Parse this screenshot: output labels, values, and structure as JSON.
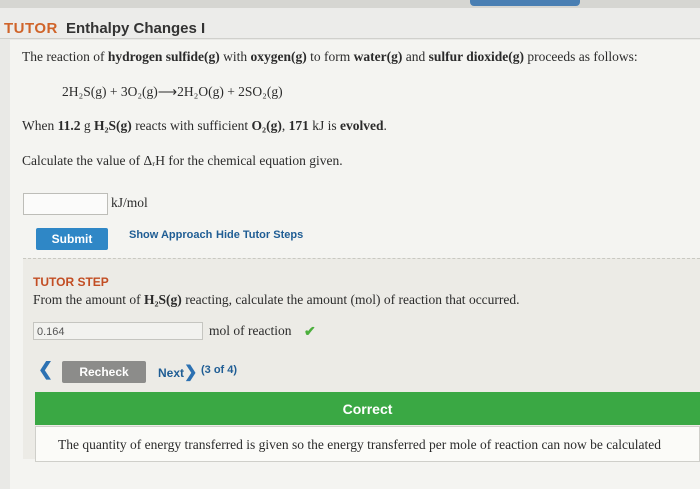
{
  "header": {
    "tutor_label": "TUTOR",
    "title": "Enthalpy Changes I"
  },
  "question": {
    "intro_a": "The reaction of ",
    "intro_b": "hydrogen sulfide(g)",
    "intro_c": " with ",
    "intro_d": "oxygen(g)",
    "intro_e": " to form ",
    "intro_f": "water(g)",
    "intro_g": " and ",
    "intro_h": "sulfur dioxide(g)",
    "intro_i": " proceeds as follows:",
    "equation": "2H₂S(g) + 3O₂(g)⟶2H₂O(g) + 2SO₂(g)",
    "given_a": "When ",
    "given_b": "11.2",
    "given_c": " g ",
    "given_d": "H₂S(g)",
    "given_e": " reacts with sufficient ",
    "given_f": "O₂(g)",
    "given_g": ", ",
    "given_h": "171",
    "given_i": " kJ is ",
    "given_j": "evolved",
    "given_k": ".",
    "prompt": "Calculate the value of ΔᵣH for the chemical equation given.",
    "answer_value": "",
    "answer_unit": "kJ/mol"
  },
  "actions": {
    "submit_label": "Submit",
    "show_approach_label": "Show Approach",
    "hide_steps_label": "Hide Tutor Steps"
  },
  "tutor_step": {
    "heading": "TUTOR STEP",
    "instruction_a": "From the amount of ",
    "instruction_b": "H₂S(g)",
    "instruction_c": " reacting, calculate the amount (mol) of reaction that occurred.",
    "answer_value": "0.164",
    "answer_unit": "mol of reaction",
    "check_mark": "✔",
    "recheck_label": "Recheck",
    "next_label": "Next",
    "step_counter": "(3 of 4)",
    "result_label": "Correct",
    "feedback": "The quantity of energy transferred is given so the energy transferred per mole of reaction can now be calculated"
  },
  "colors": {
    "accent_blue": "#2f87c6",
    "tutor_orange": "#d0642a",
    "correct_green": "#3aa844"
  },
  "icons": {
    "back": "chevron-left-icon",
    "next": "chevron-right-icon",
    "check": "check-icon"
  }
}
